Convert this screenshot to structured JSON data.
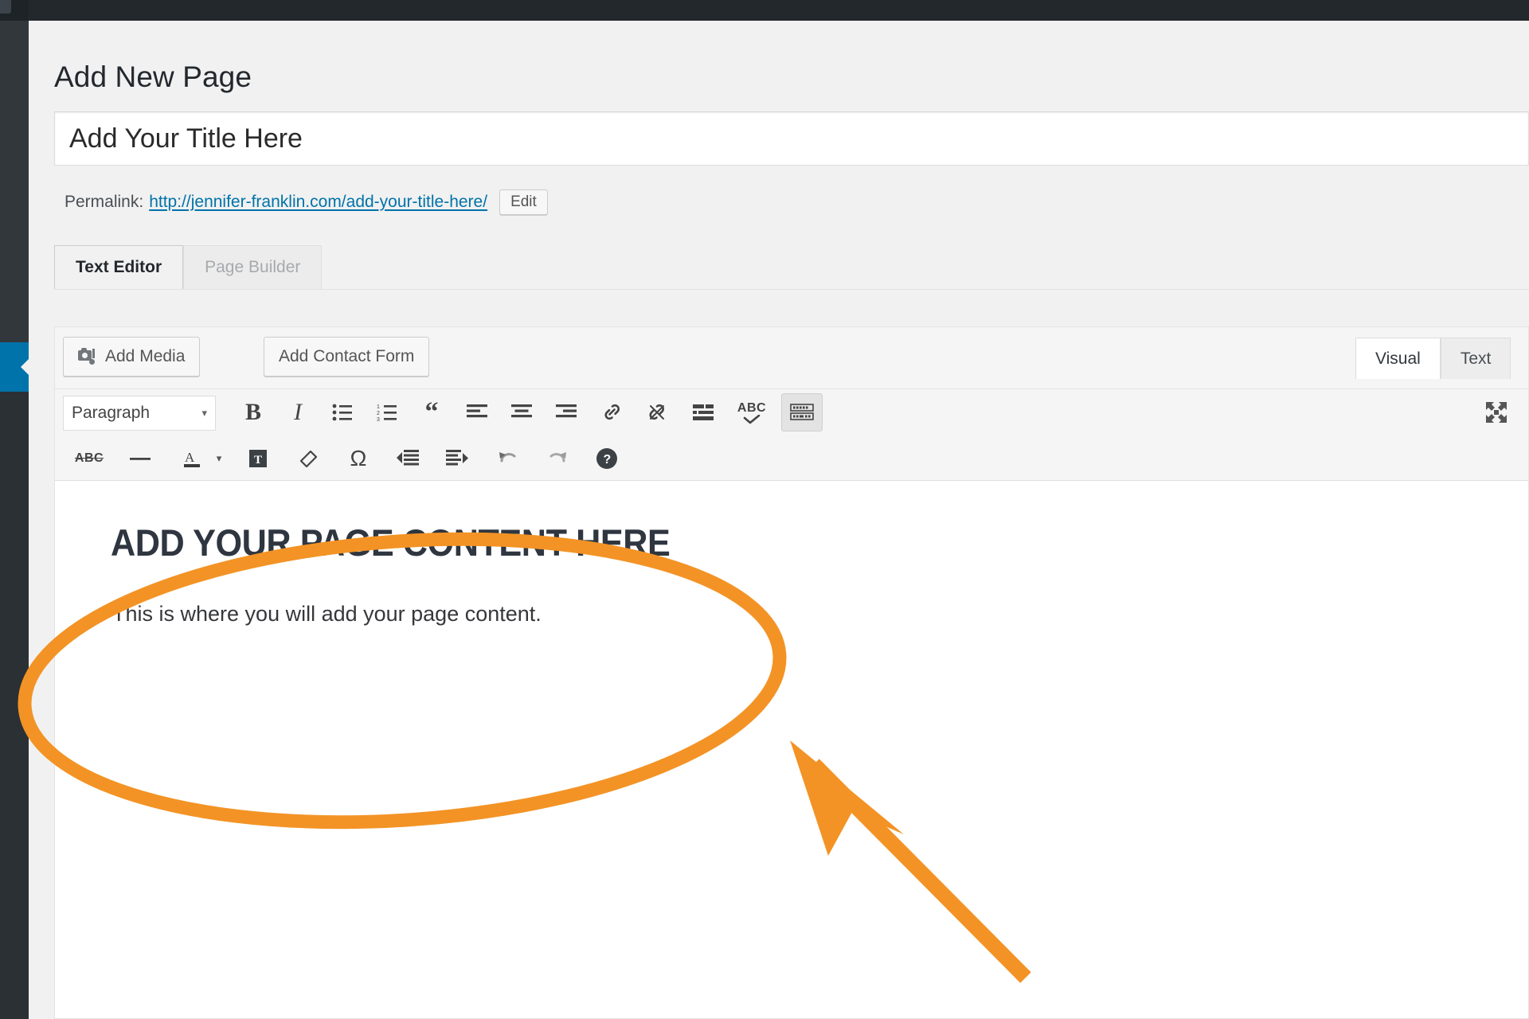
{
  "window": {
    "background_dark": "#23282d",
    "panel_background": "#f1f1f1",
    "accent_blue": "#0073aa",
    "annotation_orange": "#F39325"
  },
  "sidebar": {
    "active_item_name": "pages-menu-item-active"
  },
  "header": {
    "page_title": "Add New Page"
  },
  "title_field": {
    "value": "",
    "placeholder": "Add Your Title Here"
  },
  "permalink": {
    "label": "Permalink:",
    "base_url": "http://jennifer-franklin.com/",
    "slug": "add-your-title-here/",
    "full_url": "http://jennifer-franklin.com/add-your-title-here/",
    "edit_label": "Edit"
  },
  "mode_tabs": [
    {
      "label": "Text Editor",
      "active": true
    },
    {
      "label": "Page Builder",
      "active": false
    }
  ],
  "media_buttons": [
    {
      "label": "Add Media",
      "icon": "camera-music-icon"
    },
    {
      "label": "Add Contact Form",
      "icon": "none"
    }
  ],
  "editor_tabs": [
    {
      "label": "Visual",
      "active": true
    },
    {
      "label": "Text",
      "active": false
    }
  ],
  "toolbar": {
    "format_select": {
      "value": "Paragraph",
      "caret": "▾"
    },
    "row1": [
      {
        "name": "bold-icon",
        "title": "Bold"
      },
      {
        "name": "italic-icon",
        "title": "Italic"
      },
      {
        "name": "bulleted-list-icon",
        "title": "Bulleted list"
      },
      {
        "name": "numbered-list-icon",
        "title": "Numbered list"
      },
      {
        "name": "blockquote-icon",
        "title": "Blockquote"
      },
      {
        "name": "align-left-icon",
        "title": "Align left"
      },
      {
        "name": "align-center-icon",
        "title": "Align center"
      },
      {
        "name": "align-right-icon",
        "title": "Align right"
      },
      {
        "name": "insert-link-icon",
        "title": "Insert/edit link"
      },
      {
        "name": "unlink-icon",
        "title": "Remove link"
      },
      {
        "name": "read-more-icon",
        "title": "Insert Read More tag"
      },
      {
        "name": "spellcheck-icon",
        "title": "Spellcheck",
        "glyph": "ABC"
      },
      {
        "name": "toolbar-toggle-icon",
        "title": "Toolbar Toggle",
        "active": true
      }
    ],
    "row1_right": [
      {
        "name": "fullscreen-icon",
        "title": "Distraction-free writing mode"
      }
    ],
    "row2": [
      {
        "name": "strikethrough-icon",
        "title": "Strikethrough",
        "glyph": "ABC"
      },
      {
        "name": "horizontal-rule-icon",
        "title": "Horizontal line"
      },
      {
        "name": "text-color-icon",
        "title": "Text color",
        "glyph": "A"
      },
      {
        "name": "text-color-caret-icon",
        "title": "Text color options",
        "glyph": "▾"
      },
      {
        "name": "paste-as-text-icon",
        "title": "Paste as text",
        "glyph": "T"
      },
      {
        "name": "clear-formatting-icon",
        "title": "Clear formatting"
      },
      {
        "name": "special-character-icon",
        "title": "Special character",
        "glyph": "Ω"
      },
      {
        "name": "outdent-icon",
        "title": "Decrease indent"
      },
      {
        "name": "indent-icon",
        "title": "Increase indent"
      },
      {
        "name": "undo-icon",
        "title": "Undo"
      },
      {
        "name": "redo-icon",
        "title": "Redo"
      },
      {
        "name": "keyboard-shortcuts-help-icon",
        "title": "Keyboard Shortcuts",
        "glyph": "?"
      }
    ]
  },
  "content": {
    "heading": "ADD YOUR PAGE CONTENT HERE",
    "paragraph": "This is where you will add your page content."
  },
  "annotations": {
    "ellipse_name": "highlight-ellipse",
    "arrow_name": "callout-arrow",
    "color": "#F39325"
  }
}
